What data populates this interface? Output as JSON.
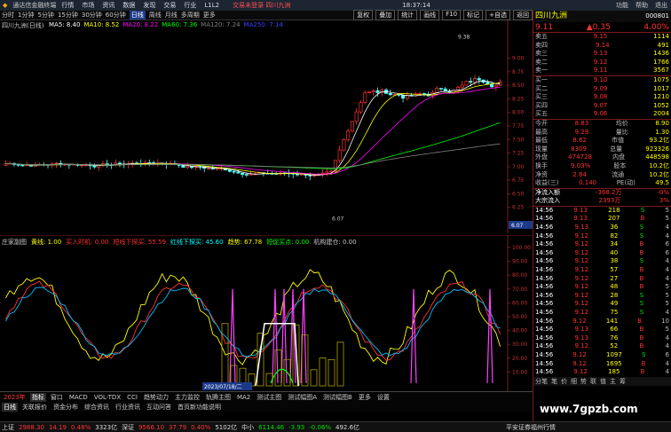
{
  "title_bar": {
    "app_name": "通达信金融终端",
    "menu": [
      "行情",
      "市场",
      "资讯",
      "数据",
      "发现",
      "交易",
      "行业",
      "L1L2"
    ],
    "center": "交易未登录  四川九洲",
    "time": "18:37:14",
    "window_menu": [
      "功能",
      "帮助",
      "退出"
    ]
  },
  "toolbar": {
    "periods": [
      "分时",
      "1分钟",
      "5分钟",
      "15分钟",
      "30分钟",
      "60分钟",
      "日线",
      "周线",
      "月线",
      "多周期",
      "更多"
    ],
    "active_period": "日线",
    "buttons": [
      "复权",
      "叠加",
      "统计",
      "画线",
      "F10",
      "标记",
      "+自选",
      "返回"
    ]
  },
  "main_chart": {
    "title": "四川九洲(日线)",
    "ma": [
      {
        "label": "MA5: 8.40",
        "color": "#ffffff"
      },
      {
        "label": "MA10: 8.52",
        "color": "#ffff00"
      },
      {
        "label": "MA20: 8.22",
        "color": "#ff00ff"
      },
      {
        "label": "MA60: 7.36",
        "color": "#00ff00"
      },
      {
        "label": "MA120: 7.24",
        "color": "#808080"
      },
      {
        "label": "MA250: 7.14",
        "color": "#4040ff"
      }
    ],
    "price_axis": [
      "9.00",
      "8.75",
      "8.50",
      "8.25",
      "8.00",
      "7.75",
      "7.50",
      "7.25",
      "7.00",
      "6.75",
      "6.50",
      "6.25"
    ],
    "high_label": "9.38",
    "low_label": "6.07",
    "current_price_tag": "6.07"
  },
  "sub_chart": {
    "title": "庄家副图",
    "legend": [
      {
        "label": "黄线: 1.00",
        "color": "#ffff00"
      },
      {
        "label": "买入时机: 0.00",
        "color": "#ff3232"
      },
      {
        "label": "短线下探买: 55.59",
        "color": "#ff3232"
      },
      {
        "label": "红线下探买: 45.60",
        "color": "#00ffff"
      },
      {
        "label": "趋势: 67.78",
        "color": "#ffff00"
      },
      {
        "label": "短促买点: 0.00",
        "color": "#00ff00"
      },
      {
        "label": "机构建仓: 0.00",
        "color": "#c8c8c8"
      }
    ],
    "axis": [
      "100.00",
      "90.00",
      "80.00",
      "70.00",
      "60.00",
      "50.00",
      "40.00",
      "30.00",
      "20.00",
      "10.00"
    ],
    "date_label": "2023/07/18/二"
  },
  "bottom_tabs": {
    "row1": [
      "指标",
      "窗口",
      "MACD",
      "VOL-TDX",
      "CCI",
      "趋势动力",
      "主力监控",
      "轨腾主图",
      "MA2",
      "测试主图",
      "测试幅图A",
      "测试幅图B",
      "更多",
      "设置"
    ],
    "row2": [
      "日线",
      "关联报价",
      "资金分布",
      "综合资讯",
      "行业资讯",
      "互动问答",
      "首页新功能说明"
    ],
    "year": "2023年"
  },
  "quote_panel": {
    "name": "四川九洲",
    "code": "000801",
    "price": "9.11",
    "change": "▲0.35",
    "pct": "4.00%",
    "asks": [
      {
        "label": "卖五",
        "price": "9.15",
        "vol": "1114"
      },
      {
        "label": "卖四",
        "price": "9.14",
        "vol": "491"
      },
      {
        "label": "卖三",
        "price": "9.13",
        "vol": "1436"
      },
      {
        "label": "卖二",
        "price": "9.12",
        "vol": "1766"
      },
      {
        "label": "卖一",
        "price": "9.11",
        "vol": "3567"
      }
    ],
    "bids": [
      {
        "label": "买一",
        "price": "9.10",
        "vol": "1075"
      },
      {
        "label": "买二",
        "price": "9.09",
        "vol": "1017"
      },
      {
        "label": "买三",
        "price": "9.08",
        "vol": "1210"
      },
      {
        "label": "买四",
        "price": "9.07",
        "vol": "1052"
      },
      {
        "label": "买五",
        "price": "9.06",
        "vol": "2004"
      }
    ],
    "stats": [
      {
        "l1": "今开",
        "v1": "8.83",
        "l2": "均价",
        "v2": "8.90"
      },
      {
        "l1": "最高",
        "v1": "9.29",
        "l2": "量比",
        "v2": "1.30"
      },
      {
        "l1": "最低",
        "v1": "8.62",
        "l2": "市值",
        "v2": "93.2亿"
      },
      {
        "l1": "现量",
        "v1": "8309",
        "l2": "总量",
        "v2": "923326"
      },
      {
        "l1": "外盘",
        "v1": "474728",
        "l2": "内盘",
        "v2": "448598"
      },
      {
        "l1": "换手",
        "v1": "9.03%",
        "l2": "股本",
        "v2": "10.2亿"
      },
      {
        "l1": "净资",
        "v1": "2.84",
        "l2": "流通",
        "v2": "10.2亿"
      },
      {
        "l1": "收益(三)",
        "v1": "0.140",
        "l2": "PE(动)",
        "v2": "49.5"
      }
    ],
    "flow": [
      {
        "label": "净流入额",
        "value": "-368.2万",
        "pct": "-0%"
      },
      {
        "label": "大宗流入",
        "value": "2393万",
        "pct": "3%"
      }
    ],
    "ticks": [
      {
        "t": "14:56",
        "p": "9.13",
        "v": "218",
        "s": "S",
        "n": "5"
      },
      {
        "t": "14:56",
        "p": "9.13",
        "v": "207",
        "s": "B",
        "n": "5"
      },
      {
        "t": "14:56",
        "p": "9.13",
        "v": "36",
        "s": "S",
        "n": "4"
      },
      {
        "t": "14:56",
        "p": "9.12",
        "v": "82",
        "s": "S",
        "n": "4"
      },
      {
        "t": "14:56",
        "p": "9.12",
        "v": "34",
        "s": "B",
        "n": "6"
      },
      {
        "t": "14:56",
        "p": "9.12",
        "v": "40",
        "s": "B",
        "n": "6"
      },
      {
        "t": "14:56",
        "p": "9.12",
        "v": "38",
        "s": "S",
        "n": "4"
      },
      {
        "t": "14:56",
        "p": "9.12",
        "v": "57",
        "s": "B",
        "n": "4"
      },
      {
        "t": "14:56",
        "p": "9.12",
        "v": "27",
        "s": "B",
        "n": "4"
      },
      {
        "t": "14:56",
        "p": "9.12",
        "v": "48",
        "s": "B",
        "n": "5"
      },
      {
        "t": "14:56",
        "p": "9.12",
        "v": "28",
        "s": "S",
        "n": "5"
      },
      {
        "t": "14:56",
        "p": "9.12",
        "v": "49",
        "s": "S",
        "n": "5"
      },
      {
        "t": "14:56",
        "p": "9.12",
        "v": "75",
        "s": "S",
        "n": "4"
      },
      {
        "t": "14:56",
        "p": "9.12",
        "v": "141",
        "s": "B",
        "n": "10"
      },
      {
        "t": "14:56",
        "p": "9.13",
        "v": "66",
        "s": "B",
        "n": "5"
      },
      {
        "t": "14:56",
        "p": "9.13",
        "v": "76",
        "s": "B",
        "n": "4"
      },
      {
        "t": "14:56",
        "p": "9.12",
        "v": "52",
        "s": "B",
        "n": "4"
      },
      {
        "t": "14:56",
        "p": "9.12",
        "v": "1097",
        "s": "S",
        "n": "6"
      },
      {
        "t": "14:56",
        "p": "9.12",
        "v": "1695",
        "s": "B",
        "n": "4"
      },
      {
        "t": "14:56",
        "p": "9.12",
        "v": "185",
        "s": "B",
        "n": "4"
      }
    ],
    "bottom_tabs": [
      "分笔",
      "笔",
      "价",
      "细",
      "势",
      "联",
      "值",
      "主",
      "筹"
    ]
  },
  "index_bar": [
    {
      "name": "上证",
      "value": "2988.30",
      "chg": "14.19",
      "pct": "0.48%",
      "amt": "3323亿",
      "color": "#ff3232"
    },
    {
      "name": "深证",
      "value": "9566.10",
      "chg": "37.79",
      "pct": "0.40%",
      "amt": "5102亿",
      "color": "#ff3232"
    },
    {
      "name": "中小",
      "value": "6114.46",
      "chg": "-3.93",
      "pct": "-0.06%",
      "amt": "492.6亿",
      "color": "#00e000"
    }
  ],
  "status_right": "平安证券福州行情",
  "watermark": "www.7gpzb.com"
}
